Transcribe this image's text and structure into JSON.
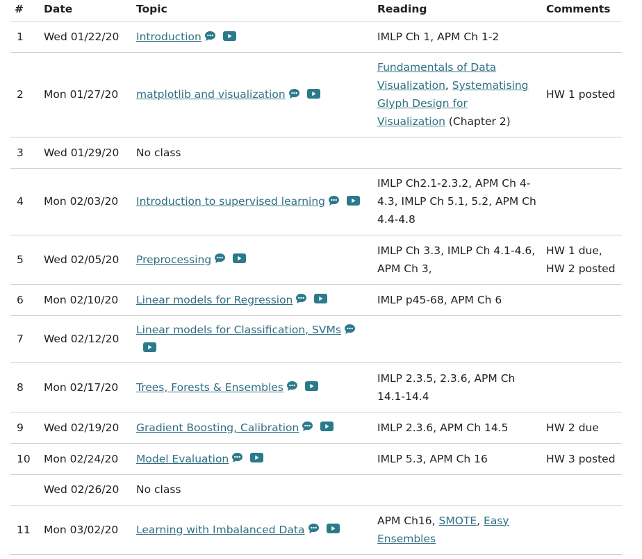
{
  "headers": [
    "#",
    "Date",
    "Topic",
    "Reading",
    "Comments"
  ],
  "icons": {
    "slides": "speech-bubble-icon",
    "video": "video-play-icon"
  },
  "colors": {
    "link": "#2f6f84",
    "icon": "#2a7a8c",
    "rule": "#cfcfcf"
  },
  "rows": [
    {
      "num": "1",
      "date": "Wed 01/22/20",
      "topic": "Introduction",
      "topic_link": true,
      "icons": true,
      "reading": [
        {
          "text": "IMLP Ch 1, APM Ch 1-2",
          "link": false
        }
      ],
      "comments": ""
    },
    {
      "num": "2",
      "date": "Mon 01/27/20",
      "topic": "matplotlib and visualization",
      "topic_link": true,
      "icons": true,
      "reading": [
        {
          "text": "Fundamentals of Data Visualization",
          "link": true
        },
        {
          "text": ", ",
          "link": false
        },
        {
          "text": "Systematising Glyph Design for Visualization",
          "link": true
        },
        {
          "text": " (Chapter 2)",
          "link": false
        }
      ],
      "comments": "HW 1 posted"
    },
    {
      "num": "3",
      "date": "Wed 01/29/20",
      "topic": "No class",
      "topic_link": false,
      "icons": false,
      "reading": [],
      "comments": ""
    },
    {
      "num": "4",
      "date": "Mon 02/03/20",
      "topic": "Introduction to supervised learning",
      "topic_link": true,
      "icons": true,
      "reading": [
        {
          "text": "IMLP Ch2.1-2.3.2, APM Ch 4-4.3, IMLP Ch 5.1, 5.2, APM Ch 4.4-4.8",
          "link": false
        }
      ],
      "comments": ""
    },
    {
      "num": "5",
      "date": "Wed 02/05/20",
      "topic": "Preprocessing",
      "topic_link": true,
      "icons": true,
      "reading": [
        {
          "text": "IMLP Ch 3.3, IMLP Ch 4.1-4.6, APM Ch 3,",
          "link": false
        }
      ],
      "comments": "HW 1 due, HW 2 posted"
    },
    {
      "num": "6",
      "date": "Mon 02/10/20",
      "topic": "Linear models for Regression",
      "topic_link": true,
      "icons": true,
      "reading": [
        {
          "text": "IMLP p45-68, APM Ch 6",
          "link": false
        }
      ],
      "comments": ""
    },
    {
      "num": "7",
      "date": "Wed 02/12/20",
      "topic": "Linear models for Classification, SVMs",
      "topic_link": true,
      "icons": true,
      "reading": [],
      "comments": ""
    },
    {
      "num": "8",
      "date": "Mon 02/17/20",
      "topic": "Trees, Forests & Ensembles",
      "topic_link": true,
      "icons": true,
      "reading": [
        {
          "text": "IMLP 2.3.5, 2.3.6, APM Ch 14.1-14.4",
          "link": false
        }
      ],
      "comments": ""
    },
    {
      "num": "9",
      "date": "Wed 02/19/20",
      "topic": "Gradient Boosting, Calibration",
      "topic_link": true,
      "icons": true,
      "reading": [
        {
          "text": "IMLP 2.3.6, APM Ch 14.5",
          "link": false
        }
      ],
      "comments": "HW 2 due"
    },
    {
      "num": "10",
      "date": "Mon 02/24/20",
      "topic": "Model Evaluation",
      "topic_link": true,
      "icons": true,
      "reading": [
        {
          "text": "IMLP 5.3, APM Ch 16",
          "link": false
        }
      ],
      "comments": "HW 3 posted"
    },
    {
      "num": "",
      "date": "Wed 02/26/20",
      "topic": "No class",
      "topic_link": false,
      "icons": false,
      "reading": [],
      "comments": ""
    },
    {
      "num": "11",
      "date": "Mon 03/02/20",
      "topic": "Learning with Imbalanced Data",
      "topic_link": true,
      "icons": true,
      "reading": [
        {
          "text": "APM Ch16, ",
          "link": false
        },
        {
          "text": "SMOTE",
          "link": true
        },
        {
          "text": ", ",
          "link": false
        },
        {
          "text": "Easy Ensembles",
          "link": true
        }
      ],
      "comments": ""
    }
  ]
}
